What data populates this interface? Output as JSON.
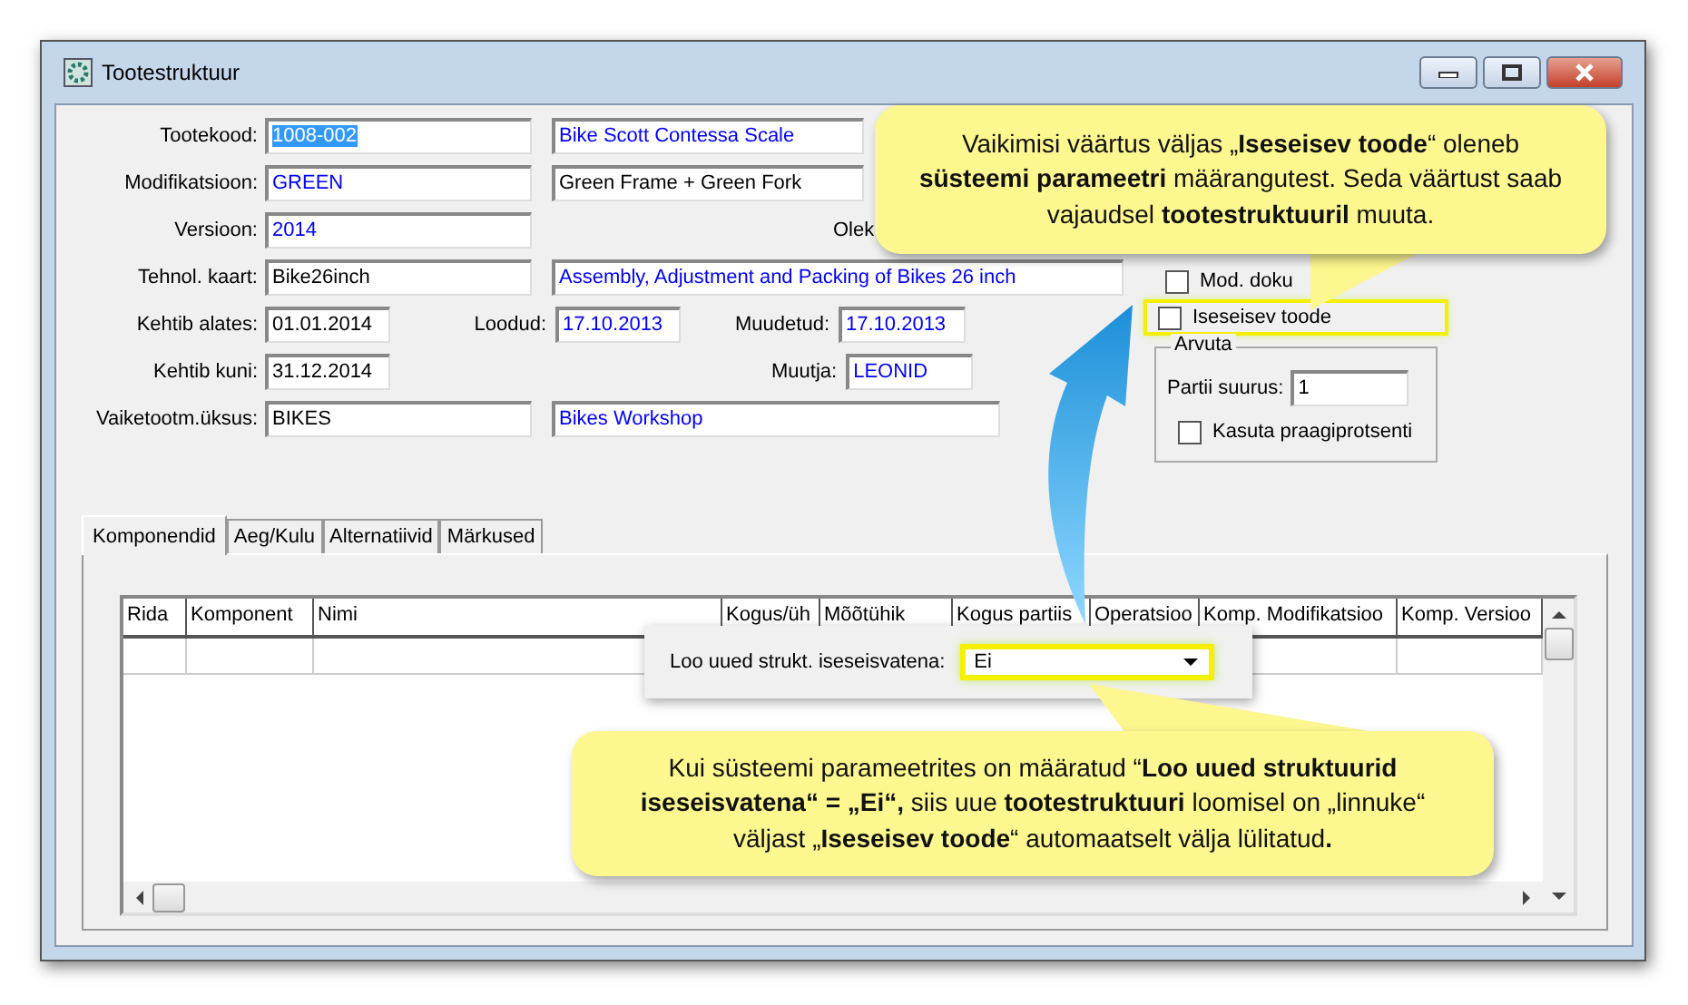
{
  "window": {
    "title": "Tootestruktuur"
  },
  "rows": [
    {
      "label": "Tootekood:",
      "fields": [
        {
          "text": "1008-002",
          "color": "#ffffff",
          "text_selected": true
        },
        {
          "text": "Bike Scott Contessa Scale",
          "color": "#0000ff",
          "text_selected": false
        }
      ]
    },
    {
      "label": "Modifikatsioon:",
      "fields": [
        {
          "text": "GREEN",
          "color": "#0000ff",
          "text_selected": false
        },
        {
          "text": "Green Frame + Green Fork",
          "color": "#000000",
          "text_selected": false
        }
      ]
    },
    {
      "label": "Versioon:",
      "fields": [
        {
          "text": "2014",
          "color": "#0000ff",
          "text_selected": false
        },
        {
          "label": "Olek"
        }
      ]
    },
    {
      "label": "Tehnol. kaart:",
      "fields": [
        {
          "text": "Bike26inch",
          "color": "#000000",
          "text_selected": false
        },
        {
          "text": "Assembly, Adjustment and Packing of Bikes 26 inch",
          "color": "#0000ff",
          "text_selected": false
        }
      ]
    },
    {
      "label": "Kehtib alates:",
      "fields": [
        {
          "text": "01.01.2014",
          "color": "#000000",
          "text_selected": false
        },
        {
          "label": "Loodud:",
          "text": "17.10.2013",
          "color": "#0000ff",
          "text_selected": false
        },
        {
          "label": "Muudetud:",
          "text": "17.10.2013",
          "color": "#0000ff",
          "text_selected": false
        }
      ]
    },
    {
      "label": "Kehtib kuni:",
      "fields": [
        {
          "text": "31.12.2014",
          "color": "#000000",
          "text_selected": false
        },
        {
          "label": "Muutja:",
          "text": "LEONID",
          "color": "#0000ff",
          "text_selected": false
        }
      ]
    },
    {
      "label": "Vaiketootm.üksus:",
      "fields": [
        {
          "text": "BIKES",
          "color": "#000000",
          "text_selected": false
        },
        {
          "text": "Bikes Workshop",
          "color": "#0000ff",
          "text_selected": false
        }
      ]
    }
  ],
  "options": [
    {
      "label": "Mod. doku",
      "checked": false,
      "highlighted": false
    },
    {
      "label": "Iseseisev toode",
      "checked": false,
      "highlighted": true
    }
  ],
  "arvuta": {
    "title": "Arvuta",
    "batch_label": "Partii suurus:",
    "batch_value": "1",
    "use_scrap": {
      "label": "Kasuta praagiprotsenti",
      "checked": false
    }
  },
  "tabs": [
    {
      "label": "Komponendid",
      "selected": true
    },
    {
      "label": "Aeg/Kulu",
      "selected": false
    },
    {
      "label": "Alternatiivid",
      "selected": false
    },
    {
      "label": "Märkused",
      "selected": false
    }
  ],
  "table": {
    "columns": [
      "Rida",
      "Komponent",
      "Nimi",
      "Kogus/üh",
      "Mõõtühik",
      "Kogus partiis",
      "Operatsioo",
      "Komp. Modifikatsioo",
      "Komp. Versioo"
    ]
  },
  "popup": {
    "label": "Loo uued strukt. iseseisvatena:",
    "value": "Ei",
    "highlighted": true
  },
  "callouts": [
    {
      "text": "Vaikimisi väärtus väljas „**Iseseisev toode**“ oleneb **süsteemi parameetri** määrangutest. Seda väärtust saab vajaudsel **tootestruktuuril** muuta."
    },
    {
      "text": "Kui süsteemi parameetrites on määratud “**Loo uued struktuurid iseseisvatena“ = „Ei“,** siis uue **tootestruktuuri** loomisel on „linnuke“ väljast „**Iseseisev toode**“ automaatselt välja lülitatud**.**"
    }
  ]
}
